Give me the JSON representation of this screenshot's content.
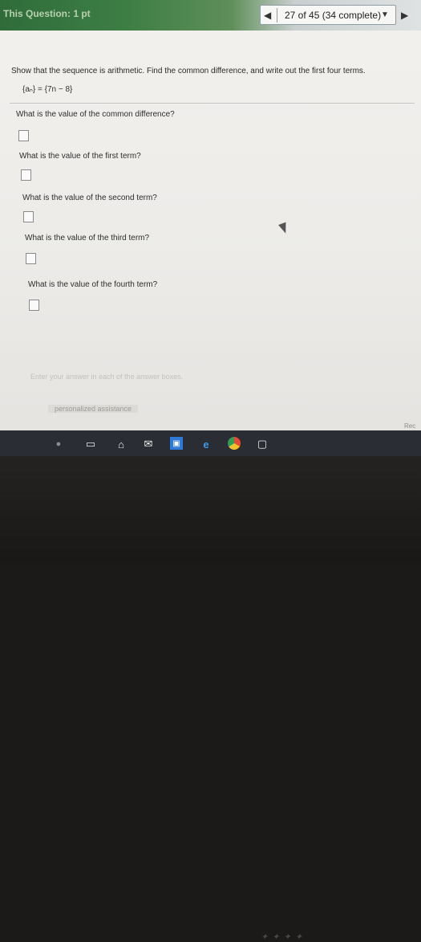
{
  "header": {
    "question_label": "This Question: 1 pt",
    "position_text": "27 of 45 (34 complete)"
  },
  "problem": {
    "prompt": "Show that the sequence is arithmetic. Find the common difference, and write out the first four terms.",
    "sequence": "{aₙ} = {7n − 8}"
  },
  "questions": [
    {
      "label": "What is the value of the common difference?",
      "value": ""
    },
    {
      "label": "What is the value of the first term?",
      "value": ""
    },
    {
      "label": "What is the value of the second term?",
      "value": ""
    },
    {
      "label": "What is the value of the third term?",
      "value": ""
    },
    {
      "label": "What is the value of the fourth term?",
      "value": ""
    }
  ],
  "footer": {
    "hint": "Enter your answer in each of the answer boxes.",
    "help_link": "personalized assistance",
    "corner_text": "Rec"
  },
  "taskbar": {
    "icons": [
      "mic-icon",
      "task-view-icon",
      "home-icon",
      "mail-icon",
      "store-icon",
      "edge-icon",
      "chrome-icon",
      "app-icon"
    ]
  },
  "colors": {
    "header_green": "#3d7e45",
    "page_bg": "#f3f1ee",
    "taskbar": "#2a2d33"
  }
}
